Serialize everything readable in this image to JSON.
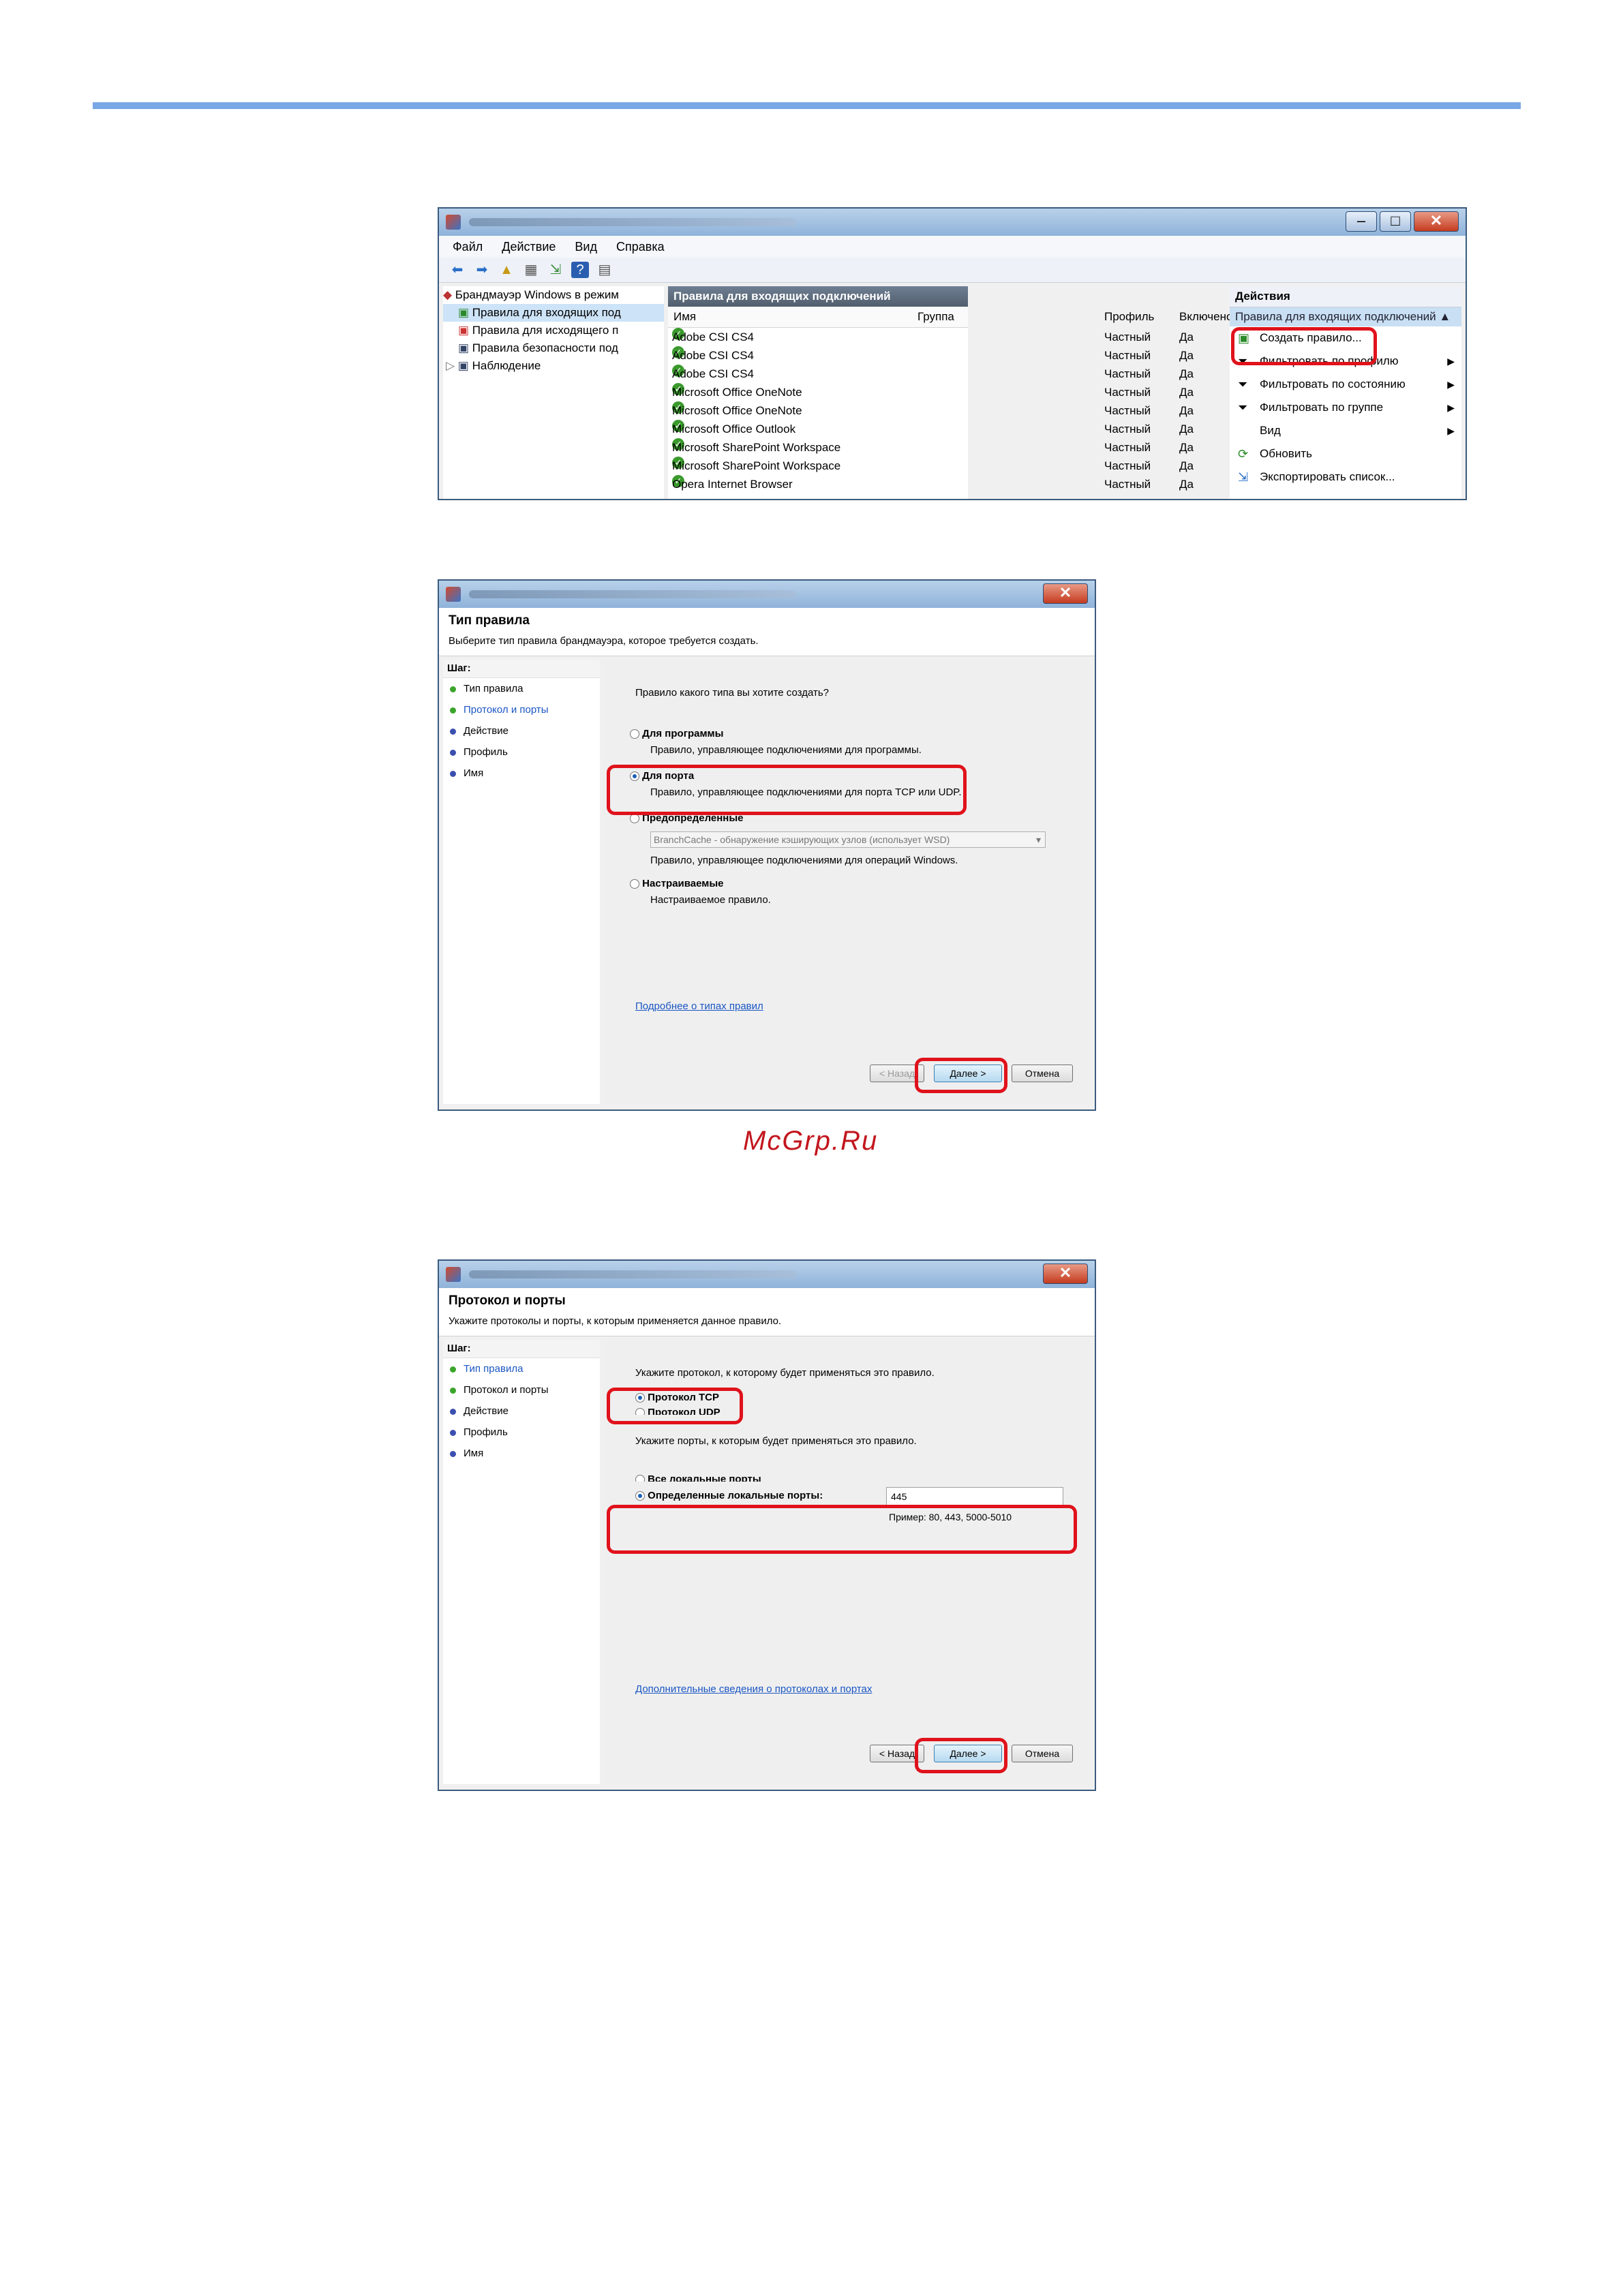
{
  "watermark": "McGrp.Ru",
  "mmc": {
    "menu": [
      "Файл",
      "Действие",
      "Вид",
      "Справка"
    ],
    "tree": [
      "Брандмауэр Windows в режим",
      "Правила для входящих под",
      "Правила для исходящего п",
      "Правила безопасности под",
      "Наблюдение"
    ],
    "center_header": "Правила для входящих подключений",
    "columns": [
      "Имя",
      "Группа",
      "Профиль",
      "Включено"
    ],
    "rows": [
      {
        "name": "Adobe CSI CS4",
        "profile": "Частный",
        "enabled": "Да"
      },
      {
        "name": "Adobe CSI CS4",
        "profile": "Частный",
        "enabled": "Да"
      },
      {
        "name": "Adobe CSI CS4",
        "profile": "Частный",
        "enabled": "Да"
      },
      {
        "name": "Microsoft Office OneNote",
        "profile": "Частный",
        "enabled": "Да"
      },
      {
        "name": "Microsoft Office OneNote",
        "profile": "Частный",
        "enabled": "Да"
      },
      {
        "name": "Microsoft Office Outlook",
        "profile": "Частный",
        "enabled": "Да"
      },
      {
        "name": "Microsoft SharePoint Workspace",
        "profile": "Частный",
        "enabled": "Да"
      },
      {
        "name": "Microsoft SharePoint Workspace",
        "profile": "Частный",
        "enabled": "Да"
      },
      {
        "name": "Opera Internet Browser",
        "profile": "Частный",
        "enabled": "Да"
      }
    ],
    "actions_header": "Действия",
    "actions_sub": "Правила для входящих подключений",
    "actions": [
      "Создать правило...",
      "Фильтровать по профилю",
      "Фильтровать по состоянию",
      "Фильтровать по группе",
      "Вид",
      "Обновить",
      "Экспортировать список..."
    ]
  },
  "wizard1": {
    "title": "Тип правила",
    "subtitle": "Выберите тип правила брандмауэра, которое требуется создать.",
    "steps_label": "Шаг:",
    "steps": [
      "Тип правила",
      "Протокол и порты",
      "Действие",
      "Профиль",
      "Имя"
    ],
    "question": "Правило какого типа вы хотите создать?",
    "opt_program": "Для программы",
    "opt_program_desc": "Правило, управляющее подключениями для программы.",
    "opt_port": "Для порта",
    "opt_port_desc": "Правило, управляющее подключениями для порта TCP или UDP.",
    "opt_predef": "Предопределенные",
    "predef_select": "BranchCache - обнаружение кэширующих узлов (использует WSD)",
    "opt_predef_desc": "Правило, управляющее подключениями для операций Windows.",
    "opt_custom": "Настраиваемые",
    "opt_custom_desc": "Настраиваемое правило.",
    "link": "Подробнее о типах правил",
    "back": "< Назад",
    "next": "Далее >",
    "cancel": "Отмена"
  },
  "wizard2": {
    "title": "Протокол и порты",
    "subtitle": "Укажите протоколы и порты, к которым применяется данное правило.",
    "steps_label": "Шаг:",
    "steps": [
      "Тип правила",
      "Протокол и порты",
      "Действие",
      "Профиль",
      "Имя"
    ],
    "protocol_question": "Укажите протокол, к которому будет применяться это правило.",
    "opt_tcp": "Протокол TCP",
    "opt_udp": "Протокол UDP",
    "ports_question": "Укажите порты, к которым будет применяться это правило.",
    "opt_all_ports": "Все локальные порты",
    "opt_specific_ports": "Определенные локальные порты:",
    "ports_value": "445",
    "ports_example": "Пример: 80, 443, 5000-5010",
    "link": "Дополнительные сведения о протоколах и портах",
    "back": "< Назад",
    "next": "Далее >",
    "cancel": "Отмена"
  }
}
